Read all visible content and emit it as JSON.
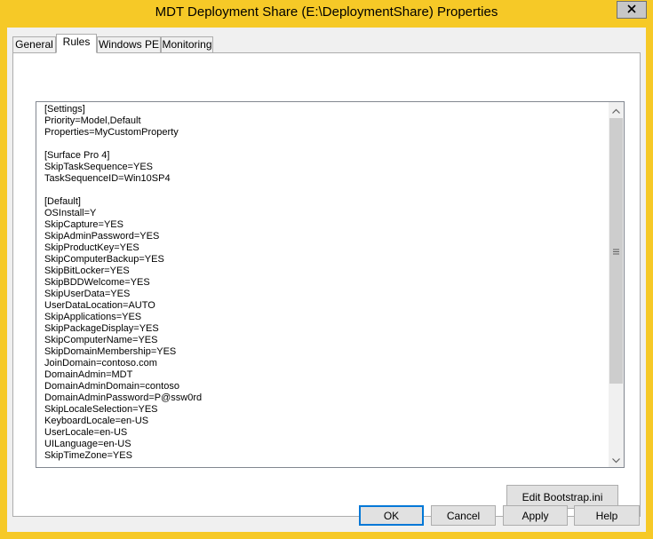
{
  "window": {
    "title": "MDT Deployment Share (E:\\DeploymentShare) Properties"
  },
  "tabs": [
    {
      "label": "General"
    },
    {
      "label": "Rules"
    },
    {
      "label": "Windows PE"
    },
    {
      "label": "Monitoring"
    }
  ],
  "active_tab": "Rules",
  "rules": {
    "lines": [
      "[Settings]",
      "Priority=Model,Default",
      "Properties=MyCustomProperty",
      "",
      "[Surface Pro 4]",
      "SkipTaskSequence=YES",
      "TaskSequenceID=Win10SP4",
      "",
      "[Default]",
      "OSInstall=Y",
      "SkipCapture=YES",
      "SkipAdminPassword=YES",
      "SkipProductKey=YES",
      "SkipComputerBackup=YES",
      "SkipBitLocker=YES",
      "SkipBDDWelcome=YES",
      "SkipUserData=YES",
      "UserDataLocation=AUTO",
      "SkipApplications=YES",
      "SkipPackageDisplay=YES",
      "SkipComputerName=YES",
      "SkipDomainMembership=YES",
      "JoinDomain=contoso.com",
      "DomainAdmin=MDT",
      "DomainAdminDomain=contoso",
      "DomainAdminPassword=P@ssw0rd",
      "SkipLocaleSelection=YES",
      "KeyboardLocale=en-US",
      "UserLocale=en-US",
      "UILanguage=en-US",
      "SkipTimeZone=YES"
    ]
  },
  "buttons": {
    "edit_bootstrap": "Edit Bootstrap.ini",
    "ok": "OK",
    "cancel": "Cancel",
    "apply": "Apply",
    "help": "Help"
  },
  "colors": {
    "title_bar": "#f6c927",
    "dialog_bg": "#f0f0f0",
    "default_button_border": "#0078d7"
  },
  "icons": {
    "close": "close-icon",
    "scroll_up": "chevron-up-icon",
    "scroll_down": "chevron-down-icon",
    "scroll_grip": "grip-icon"
  }
}
